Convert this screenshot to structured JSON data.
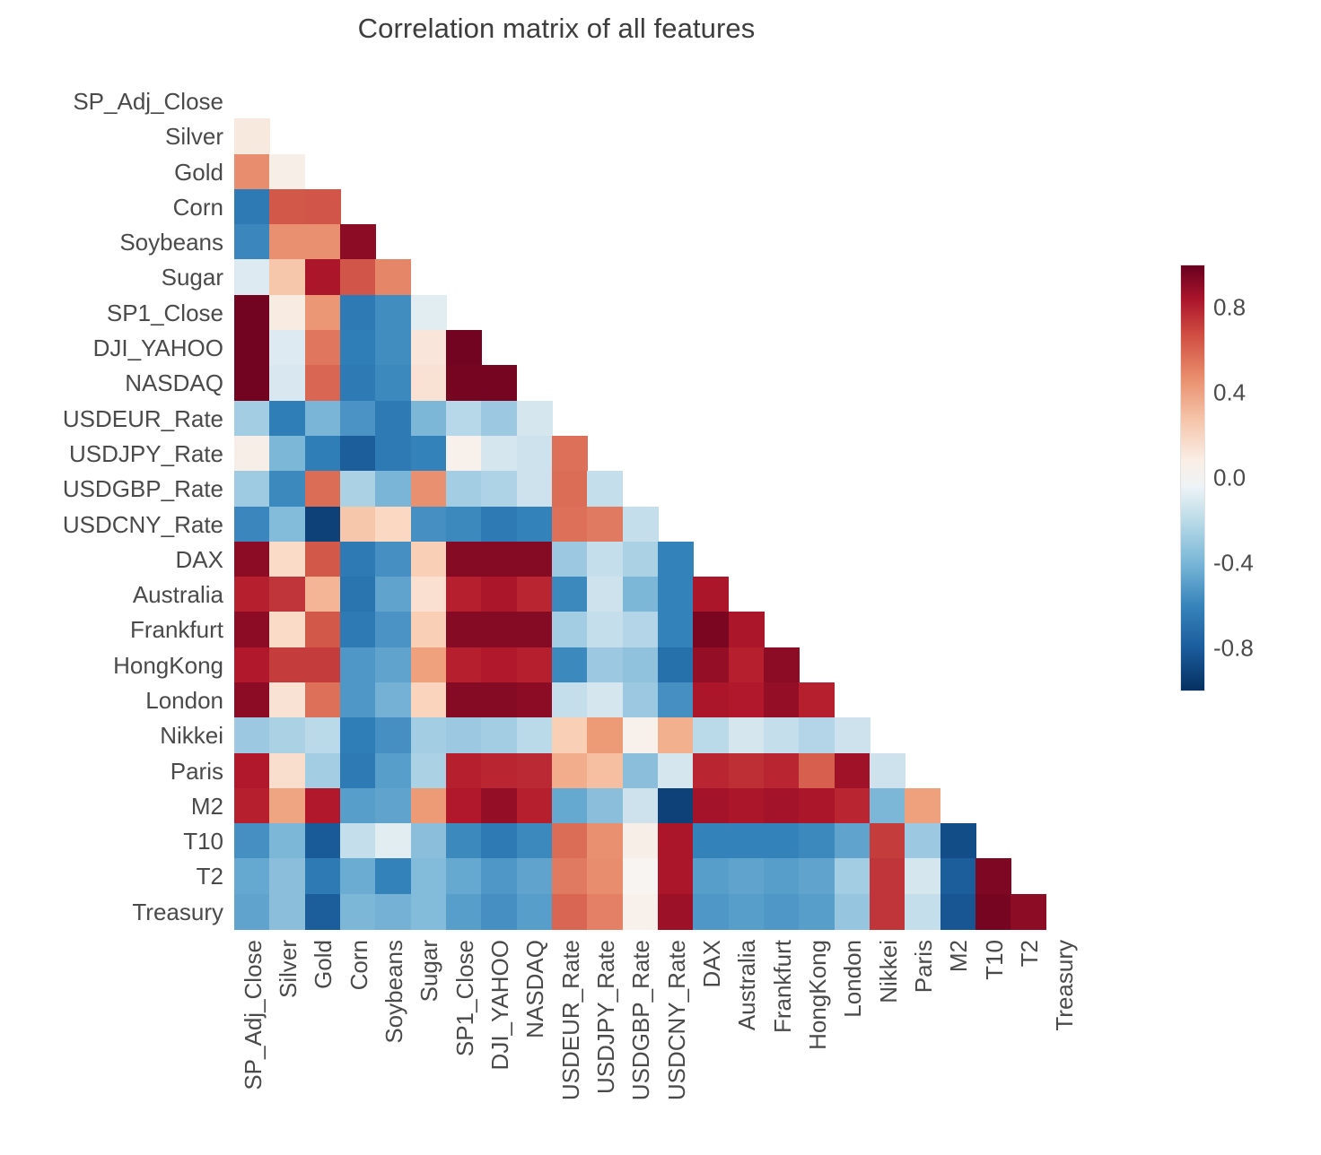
{
  "chart_data": {
    "type": "heatmap",
    "title": "Correlation matrix of all features",
    "xlabel": "",
    "ylabel": "",
    "mask": "upper-triangle-hidden",
    "colormap": "RdBu_r",
    "vmin": -1.0,
    "vmax": 1.0,
    "grid": false,
    "legend_position": "right",
    "colorbar": {
      "ticks": [
        "0.8",
        "0.4",
        "0.0",
        "-0.4",
        "-0.8"
      ],
      "tick_values": [
        0.8,
        0.4,
        0.0,
        -0.4,
        -0.8
      ],
      "low_color": "#053061",
      "mid_color": "#f7f7f7",
      "high_color": "#67001f"
    },
    "labels": [
      "SP_Adj_Close",
      "Silver",
      "Gold",
      "Corn",
      "Soybeans",
      "Sugar",
      "SP1_Close",
      "DJI_YAHOO",
      "NASDAQ",
      "USDEUR_Rate",
      "USDJPY_Rate",
      "USDGBP_Rate",
      "USDCNY_Rate",
      "DAX",
      "Australia",
      "Frankfurt",
      "HongKong",
      "London",
      "Nikkei",
      "Paris",
      "M2",
      "T10",
      "T2",
      "Treasury"
    ],
    "categories": [
      "SP_Adj_Close",
      "Silver",
      "Gold",
      "Corn",
      "Soybeans",
      "Sugar",
      "SP1_Close",
      "DJI_YAHOO",
      "NASDAQ",
      "USDEUR_Rate",
      "USDJPY_Rate",
      "USDGBP_Rate",
      "USDCNY_Rate",
      "DAX",
      "Australia",
      "Frankfurt",
      "HongKong",
      "London",
      "Nikkei",
      "Paris",
      "M2",
      "T10",
      "T2",
      "Treasury"
    ],
    "row_labels": [
      "SP_Adj_Close",
      "Silver",
      "Gold",
      "Corn",
      "Soybeans",
      "Sugar",
      "SP1_Close",
      "DJI_YAHOO",
      "NASDAQ",
      "USDEUR_Rate",
      "USDJPY_Rate",
      "USDGBP_Rate",
      "USDCNY_Rate",
      "DAX",
      "Australia",
      "Frankfurt",
      "HongKong",
      "London",
      "Nikkei",
      "Paris",
      "M2",
      "T10",
      "T2",
      "Treasury"
    ],
    "note": "Lower-triangle heatmap; first row (SP_Adj_Close) and last column (Treasury) are fully masked. Values are read from the RdBu_r color scale.",
    "values": [
      [
        null,
        null,
        null,
        null,
        null,
        null,
        null,
        null,
        null,
        null,
        null,
        null,
        null,
        null,
        null,
        null,
        null,
        null,
        null,
        null,
        null,
        null,
        null,
        null
      ],
      [
        0.08,
        null,
        null,
        null,
        null,
        null,
        null,
        null,
        null,
        null,
        null,
        null,
        null,
        null,
        null,
        null,
        null,
        null,
        null,
        null,
        null,
        null,
        null,
        null
      ],
      [
        0.46,
        0.05,
        null,
        null,
        null,
        null,
        null,
        null,
        null,
        null,
        null,
        null,
        null,
        null,
        null,
        null,
        null,
        null,
        null,
        null,
        null,
        null,
        null,
        null
      ],
      [
        -0.62,
        0.62,
        0.63,
        null,
        null,
        null,
        null,
        null,
        null,
        null,
        null,
        null,
        null,
        null,
        null,
        null,
        null,
        null,
        null,
        null,
        null,
        null,
        null,
        null
      ],
      [
        -0.56,
        0.45,
        0.45,
        0.9,
        null,
        null,
        null,
        null,
        null,
        null,
        null,
        null,
        null,
        null,
        null,
        null,
        null,
        null,
        null,
        null,
        null,
        null,
        null,
        null
      ],
      [
        -0.06,
        0.25,
        0.82,
        0.63,
        0.48,
        null,
        null,
        null,
        null,
        null,
        null,
        null,
        null,
        null,
        null,
        null,
        null,
        null,
        null,
        null,
        null,
        null,
        null,
        null
      ],
      [
        0.97,
        0.07,
        0.43,
        -0.62,
        -0.53,
        -0.05,
        null,
        null,
        null,
        null,
        null,
        null,
        null,
        null,
        null,
        null,
        null,
        null,
        null,
        null,
        null,
        null,
        null,
        null
      ],
      [
        0.97,
        -0.06,
        0.53,
        -0.6,
        -0.53,
        0.1,
        0.97,
        null,
        null,
        null,
        null,
        null,
        null,
        null,
        null,
        null,
        null,
        null,
        null,
        null,
        null,
        null,
        null,
        null
      ],
      [
        0.97,
        -0.07,
        0.58,
        -0.62,
        -0.55,
        0.12,
        0.96,
        0.96,
        null,
        null,
        null,
        null,
        null,
        null,
        null,
        null,
        null,
        null,
        null,
        null,
        null,
        null,
        null,
        null
      ],
      [
        -0.2,
        -0.6,
        -0.33,
        -0.5,
        -0.62,
        -0.32,
        -0.15,
        -0.22,
        -0.08,
        null,
        null,
        null,
        null,
        null,
        null,
        null,
        null,
        null,
        null,
        null,
        null,
        null,
        null,
        null
      ],
      [
        0.05,
        -0.32,
        -0.6,
        -0.78,
        -0.62,
        -0.58,
        0.04,
        -0.08,
        -0.1,
        0.55,
        null,
        null,
        null,
        null,
        null,
        null,
        null,
        null,
        null,
        null,
        null,
        null,
        null,
        null
      ],
      [
        -0.21,
        -0.55,
        0.56,
        -0.18,
        -0.33,
        0.45,
        -0.2,
        -0.17,
        -0.1,
        0.56,
        -0.12,
        null,
        null,
        null,
        null,
        null,
        null,
        null,
        null,
        null,
        null,
        null,
        null,
        null
      ],
      [
        -0.56,
        -0.3,
        -0.92,
        0.25,
        0.18,
        -0.52,
        -0.55,
        -0.62,
        -0.58,
        0.55,
        0.52,
        -0.12,
        null,
        null,
        null,
        null,
        null,
        null,
        null,
        null,
        null,
        null,
        null,
        null
      ],
      [
        0.9,
        0.16,
        0.62,
        -0.62,
        -0.52,
        0.22,
        0.92,
        0.92,
        0.92,
        -0.22,
        -0.12,
        -0.18,
        -0.58,
        null,
        null,
        null,
        null,
        null,
        null,
        null,
        null,
        null,
        null,
        null
      ],
      [
        0.78,
        0.72,
        0.32,
        -0.65,
        -0.42,
        0.13,
        0.78,
        0.82,
        0.76,
        -0.55,
        -0.1,
        -0.32,
        -0.58,
        0.82,
        null,
        null,
        null,
        null,
        null,
        null,
        null,
        null,
        null,
        null
      ],
      [
        0.9,
        0.16,
        0.62,
        -0.62,
        -0.5,
        0.22,
        0.92,
        0.92,
        0.92,
        -0.2,
        -0.12,
        -0.16,
        -0.58,
        0.95,
        0.82,
        null,
        null,
        null,
        null,
        null,
        null,
        null,
        null,
        null
      ],
      [
        0.8,
        0.7,
        0.7,
        -0.48,
        -0.42,
        0.4,
        0.78,
        0.8,
        0.78,
        -0.55,
        -0.22,
        -0.26,
        -0.68,
        0.88,
        0.78,
        0.9,
        null,
        null,
        null,
        null,
        null,
        null,
        null,
        null
      ],
      [
        0.9,
        0.12,
        0.55,
        -0.48,
        -0.35,
        0.2,
        0.92,
        0.92,
        0.9,
        -0.12,
        -0.08,
        -0.22,
        -0.52,
        0.82,
        0.8,
        0.88,
        0.78,
        null,
        null,
        null,
        null,
        null,
        null,
        null
      ],
      [
        -0.22,
        -0.18,
        -0.14,
        -0.6,
        -0.52,
        -0.2,
        -0.22,
        -0.2,
        -0.14,
        0.22,
        0.42,
        0.04,
        0.34,
        -0.14,
        -0.08,
        -0.12,
        -0.16,
        -0.1,
        null,
        null,
        null,
        null,
        null,
        null
      ],
      [
        0.8,
        0.14,
        -0.2,
        -0.62,
        -0.45,
        -0.18,
        0.78,
        0.76,
        0.75,
        0.35,
        0.28,
        -0.28,
        -0.08,
        0.76,
        0.74,
        0.76,
        0.6,
        0.85,
        -0.1,
        null,
        null,
        null,
        null,
        null
      ],
      [
        0.78,
        0.38,
        0.8,
        -0.45,
        -0.42,
        0.42,
        0.8,
        0.88,
        0.78,
        -0.4,
        -0.28,
        -0.1,
        -0.92,
        0.84,
        0.82,
        0.84,
        0.82,
        0.76,
        -0.32,
        0.4,
        null,
        null,
        null,
        null
      ],
      [
        -0.52,
        -0.32,
        -0.8,
        -0.12,
        -0.05,
        -0.28,
        -0.55,
        -0.62,
        -0.55,
        0.56,
        0.45,
        0.05,
        0.82,
        -0.58,
        -0.58,
        -0.58,
        -0.55,
        -0.42,
        0.7,
        -0.22,
        -0.86,
        null,
        null,
        null
      ],
      [
        -0.4,
        -0.28,
        -0.62,
        -0.38,
        -0.58,
        -0.3,
        -0.4,
        -0.48,
        -0.42,
        0.52,
        0.46,
        0.02,
        0.82,
        -0.45,
        -0.42,
        -0.45,
        -0.42,
        -0.2,
        0.72,
        -0.08,
        -0.78,
        0.94,
        null,
        null
      ],
      [
        -0.42,
        -0.28,
        -0.78,
        -0.32,
        -0.35,
        -0.3,
        -0.45,
        -0.52,
        -0.45,
        0.58,
        0.5,
        0.04,
        0.86,
        -0.48,
        -0.45,
        -0.48,
        -0.45,
        -0.24,
        0.72,
        -0.12,
        -0.82,
        0.96,
        0.9,
        null
      ]
    ]
  }
}
